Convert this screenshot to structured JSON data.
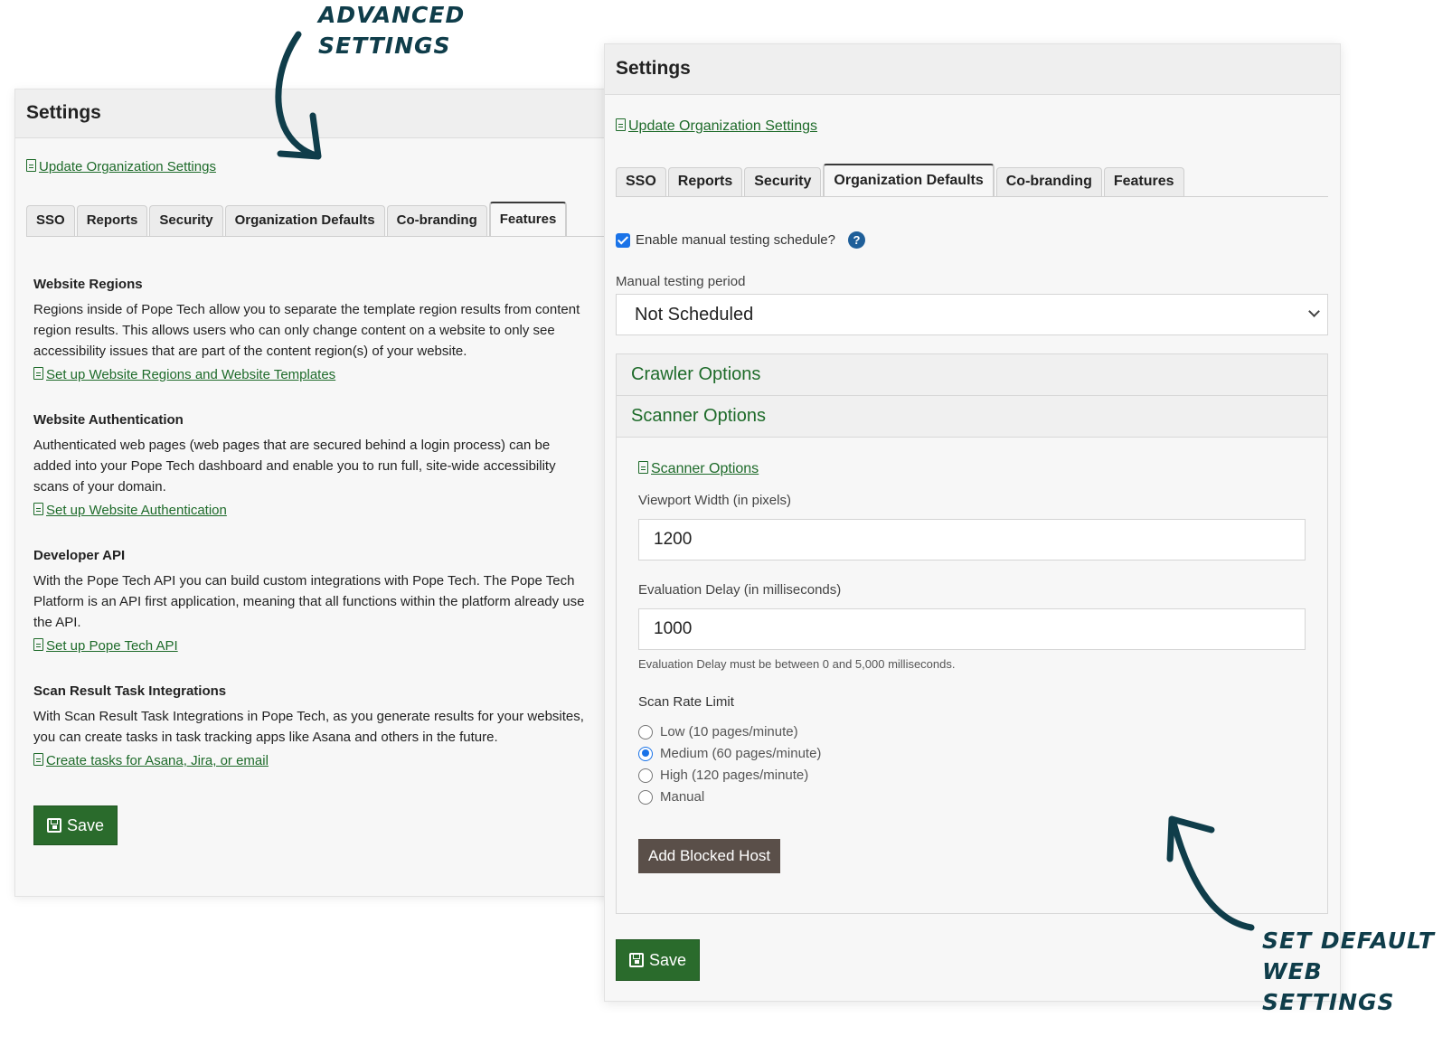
{
  "annotations": {
    "advanced_line1": "ADVANCED",
    "advanced_line2": "SETTINGS",
    "default_line1": "SET DEFAULT",
    "default_line2": "WEB SETTINGS"
  },
  "left_panel": {
    "title": "Settings",
    "update_link": "Update Organization Settings",
    "tabs": [
      "SSO",
      "Reports",
      "Security",
      "Organization Defaults",
      "Co-branding",
      "Features"
    ],
    "active_tab": "Features",
    "sections": [
      {
        "heading": "Website Regions",
        "text": "Regions inside of Pope Tech allow you to separate the template region results from content region results. This allows users who can only change content on a website to only see accessibility issues that are part of the content region(s) of your website.",
        "link": "Set up Website Regions and Website Templates"
      },
      {
        "heading": "Website Authentication",
        "text": "Authenticated web pages (web pages that are secured behind a login process) can be added into your Pope Tech dashboard and enable you to run full, site-wide accessibility scans of your domain.",
        "link": "Set up Website Authentication"
      },
      {
        "heading": "Developer API",
        "text": "With the Pope Tech API you can build custom integrations with Pope Tech. The Pope Tech Platform is an API first application, meaning that all functions within the platform already use the API.",
        "link": "Set up Pope Tech API"
      },
      {
        "heading": "Scan Result Task Integrations",
        "text": "With Scan Result Task Integrations in Pope Tech, as you generate results for your websites, you can create tasks in task tracking apps like Asana and others in the future.",
        "link": "Create tasks for Asana, Jira, or email"
      }
    ],
    "save_label": "Save"
  },
  "right_panel": {
    "title": "Settings",
    "update_link": "Update Organization Settings",
    "tabs": [
      "SSO",
      "Reports",
      "Security",
      "Organization Defaults",
      "Co-branding",
      "Features"
    ],
    "active_tab": "Organization Defaults",
    "checkbox_label": "Enable manual testing schedule?",
    "checkbox_checked": true,
    "help_glyph": "?",
    "period_label": "Manual testing period",
    "period_value": "Not Scheduled",
    "crawler_options": "Crawler Options",
    "scanner_options": "Scanner Options",
    "scanner_link": "Scanner Options",
    "viewport_label": "Viewport Width (in pixels)",
    "viewport_value": "1200",
    "delay_label": "Evaluation Delay (in milliseconds)",
    "delay_value": "1000",
    "delay_hint": "Evaluation Delay must be between 0 and 5,000 milliseconds.",
    "rate_label": "Scan Rate Limit",
    "rate_options": [
      "Low (10 pages/minute)",
      "Medium (60 pages/minute)",
      "High (120 pages/minute)",
      "Manual"
    ],
    "rate_selected": "Medium (60 pages/minute)",
    "add_blocked_host": "Add Blocked Host",
    "save_label": "Save"
  },
  "colors": {
    "accent_green": "#2a6b2c",
    "link_green": "#1e6b2a",
    "annotation": "#0f3d4a",
    "checkbox_blue": "#1a73e8",
    "dark_button": "#5a4f49"
  }
}
